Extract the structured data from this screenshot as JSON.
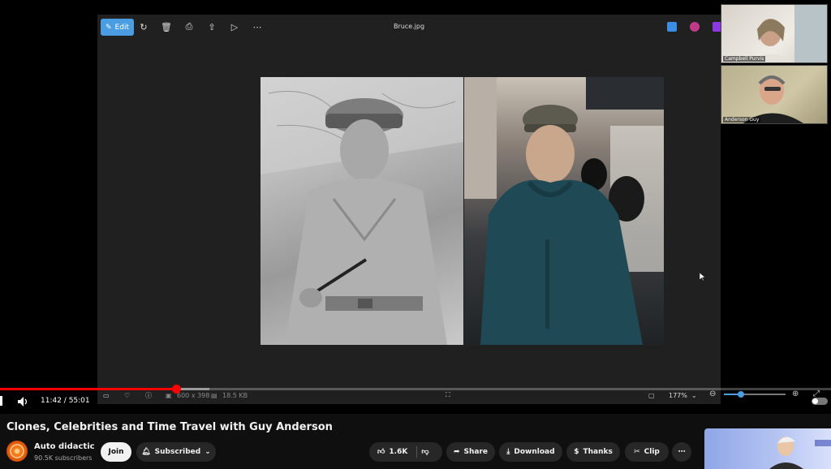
{
  "photos": {
    "edit_label": "Edit",
    "file_name": "Bruce.jpg",
    "image_dims": "600 x 398",
    "file_size": "18.5 KB",
    "zoom": "177%"
  },
  "participants": [
    {
      "name": "Campbell Purvis"
    },
    {
      "name": "Anderson Guy"
    }
  ],
  "player": {
    "current_time": "11:42 / 55:01",
    "played_fraction": 0.212,
    "buffered_fraction": 0.252
  },
  "video": {
    "title": "Clones, Celebrities and Time Travel with Guy Anderson",
    "channel": "Auto didactic",
    "subscribers": "90.5K subscribers"
  },
  "actions": {
    "join": "Join",
    "subscribed": "Subscribed",
    "likes": "1.6K",
    "share": "Share",
    "download": "Download",
    "thanks": "Thanks",
    "clip": "Clip"
  },
  "colors": {
    "accent_edit": "#4a9de0",
    "progress": "#ff0000"
  }
}
